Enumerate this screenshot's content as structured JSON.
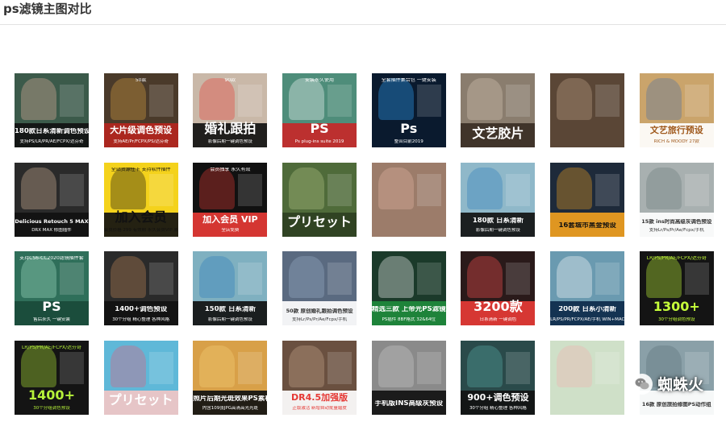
{
  "page_title": "ps滤镜主图对比",
  "watermark": {
    "text": "蜘蛛火",
    "icon": "wechat-icon"
  },
  "thumbnails": [
    {
      "main": "180款日系清新调色预设",
      "sub": "支持PS/LR/PR/AE/FCPX/达芬奇",
      "bg": "#3b5a4a",
      "band": "#111111",
      "fg": "#ffffff",
      "accent": "#e8b4a0"
    },
    {
      "main": "大片级调色预设",
      "sub": "支持AE/Pr/FCPX/PS/达芬奇",
      "bg": "#4a3a2a",
      "band": "#b3261e",
      "fg": "#ffffff",
      "accent": "#d9a441",
      "extra": "50款"
    },
    {
      "main": "婚礼跟拍",
      "sub": "影像后期一键调色预设",
      "bg": "#c9b8a8",
      "band": "#111111",
      "fg": "#ffffff",
      "accent": "#e53935",
      "extra": "90款"
    },
    {
      "main": "PS",
      "sub": "Ps plug-ins suite 2019",
      "bg": "#4e8d7a",
      "band": "#c62828",
      "fg": "#ffffff",
      "accent": "#ffffff",
      "extra": "安装永久使用"
    },
    {
      "main": "Ps",
      "sub": "整合目前2019",
      "bg": "#0a1a2e",
      "band": "#0a1a2e",
      "fg": "#ffffff",
      "accent": "#31a8ff",
      "extra": "全套插件集合包 一键安装"
    },
    {
      "main": "文艺胶片",
      "sub": "",
      "bg": "#8a7d6e",
      "band": "#3a2e24",
      "fg": "#ffffff",
      "accent": "#d7c9b6"
    },
    {
      "main": "",
      "sub": "",
      "bg": "#5a4636",
      "band": "#2e231b",
      "fg": "#ffffff",
      "accent": "#c2a58a"
    },
    {
      "main": "文艺旅行预设",
      "sub": "RICH & MOODY 27款",
      "bg": "#caa46b",
      "band": "#ffffff",
      "fg": "#a05a1e",
      "accent": "#4a6fa5"
    },
    {
      "main": "Delicious Retouch 5 MAX",
      "sub": "DRX MAX 修图插件",
      "bg": "#2a2a2a",
      "band": "#111111",
      "fg": "#ffffff",
      "accent": "#d8b79b"
    },
    {
      "main": "加入会员",
      "sub": "会员价格 299 有效期 永久会员VIP 原价199 新增一年",
      "bg": "#f4d21c",
      "band": "#111111",
      "fg": "#111111",
      "accent": "#111111",
      "extra": "全站资源任下 支持软件插件"
    },
    {
      "main": "加入会员 VIP",
      "sub": "全店免费",
      "bg": "#111111",
      "band": "#e53935",
      "fg": "#ffffff",
      "accent": "#e53935",
      "extra": "会员独享 永久有效"
    },
    {
      "main": "プリセット",
      "sub": "",
      "bg": "#4f6b3a",
      "band": "#2e4022",
      "fg": "#ffffff",
      "accent": "#b8c98a"
    },
    {
      "main": "",
      "sub": "",
      "bg": "#9c7c6a",
      "band": "#6b4f40",
      "fg": "#ffffff",
      "accent": "#e6b8a2"
    },
    {
      "main": "180款 日系清新",
      "sub": "影像后期一键调色预设",
      "bg": "#8fb8c9",
      "band": "#111111",
      "fg": "#ffffff",
      "accent": "#2b7bb9"
    },
    {
      "main": "16套城市黑金预设",
      "sub": "",
      "bg": "#1e2a3a",
      "band": "#f0a020",
      "fg": "#111111",
      "accent": "#f0a020"
    },
    {
      "main": "15款 ins时尚高级灰调色预设",
      "sub": "支持Lr/Ps/Pr/Ae/Fcpx/手机",
      "bg": "#a8b0b0",
      "band": "#ffffff",
      "fg": "#333333",
      "accent": "#6a7a7a"
    },
    {
      "main": "PS",
      "sub": "售后永久 一键安装",
      "bg": "#2f6f5a",
      "band": "#1a4a3a",
      "fg": "#ffffff",
      "accent": "#a6e2c8",
      "extra": "支持CS6-CC2020滤镜插件套"
    },
    {
      "main": "1400+调色预设",
      "sub": "30个分组 精心整理 各种风格",
      "bg": "#2a2a2a",
      "band": "#111111",
      "fg": "#ffffff",
      "accent": "#c28a5a"
    },
    {
      "main": "150款 日系清新",
      "sub": "影像后期一键调色预设",
      "bg": "#7fb0c0",
      "band": "#111111",
      "fg": "#ffffff",
      "accent": "#2b7bb9"
    },
    {
      "main": "50款 原创婚礼跟拍调色预设",
      "sub": "支持Lr/Ps/Pr/Ae/Fcpx/手机",
      "bg": "#5a6a80",
      "band": "#ffffff",
      "fg": "#333333",
      "accent": "#9ab0c8"
    },
    {
      "main": "精选三款 上帝光PS滤镜",
      "sub": "PS插件 8BF格式 32&64位",
      "bg": "#1b3a2a",
      "band": "#1e8a3c",
      "fg": "#ffffff",
      "accent": "#ffffff"
    },
    {
      "main": "3200款",
      "sub": "日系清新 一键调色",
      "bg": "#2a1a1a",
      "band": "#e53935",
      "fg": "#ffffff",
      "accent": "#ff5252"
    },
    {
      "main": "200款 日系小清新",
      "sub": "LR/PS/PR/FCPX/AE/手机 WIN+MAC",
      "bg": "#6a9ab0",
      "band": "#0d2a4a",
      "fg": "#ffffff",
      "accent": "#ffffff"
    },
    {
      "main": "1300+",
      "sub": "30个分组调色预设",
      "bg": "#141414",
      "band": "#141414",
      "fg": "#c6ff3a",
      "accent": "#c6ff3a",
      "extra": "LR/PS/PR/AE/FCPX/达芬奇"
    },
    {
      "main": "1400+",
      "sub": "30个分组调色预设",
      "bg": "#141414",
      "band": "#141414",
      "fg": "#b6f23a",
      "accent": "#b6f23a",
      "extra": "LR/PS/PR/AE/FCPX/达芬奇"
    },
    {
      "main": "プリセット",
      "sub": "",
      "bg": "#5fb8d8",
      "band": "#f2c6c6",
      "fg": "#ffffff",
      "accent": "#e85a7a"
    },
    {
      "main": "照片后期光斑效果PS素材",
      "sub": "内含109张JPG高清高光光斑",
      "bg": "#d8a048",
      "band": "#111111",
      "fg": "#ffffff",
      "accent": "#f5d27a"
    },
    {
      "main": "DR4.5加强版",
      "sub": "正版激活 新增自动批量磨皮",
      "bg": "#6a5040",
      "band": "#ffffff",
      "fg": "#e53935",
      "accent": "#c8a890"
    },
    {
      "main": "手机版INS高级灰预设",
      "sub": "",
      "bg": "#8a8a8a",
      "band": "#111111",
      "fg": "#ffffff",
      "accent": "#cccccc"
    },
    {
      "main": "900+调色预设",
      "sub": "30个分组 精心整理 各种风格",
      "bg": "#2a4a4a",
      "band": "#111111",
      "fg": "#ffffff",
      "accent": "#5ab0a8"
    },
    {
      "main": "",
      "sub": "",
      "bg": "#cfe0c8",
      "band": "#ffffff",
      "fg": "#2a5a3a",
      "accent": "#f0b0b0"
    },
    {
      "main": "16款 原创旅拍修图PS动作组",
      "sub": "",
      "bg": "#8aa0a8",
      "band": "#ffffff",
      "fg": "#333333",
      "accent": "#5a7078"
    }
  ]
}
